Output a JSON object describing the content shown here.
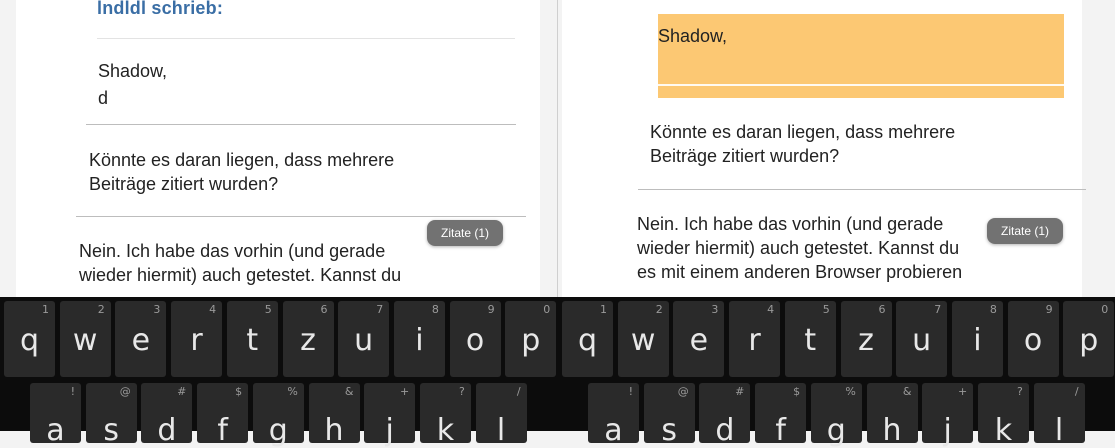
{
  "left_pane": {
    "quote_author": "lndldl schrieb:",
    "quote_lines": [
      "Shadow,",
      "d"
    ],
    "question_lines": [
      "Könnte es daran liegen, dass mehrere",
      "Beiträge zitiert wurden?"
    ],
    "reply_lines": [
      "Nein. Ich habe das vorhin (und gerade",
      "wieder hiermit) auch getestet. Kannst du"
    ],
    "quote_button": "Zitate (1)"
  },
  "right_pane": {
    "highlight_text": "Shadow,",
    "question_lines": [
      "Könnte es daran liegen, dass mehrere",
      "Beiträge zitiert wurden?"
    ],
    "reply_lines": [
      "Nein. Ich habe das vorhin (und gerade",
      "wieder hiermit) auch getestet. Kannst du",
      "es mit einem anderen Browser probieren"
    ],
    "quote_button": "Zitate (1)",
    "highlight_color": "#fcc873"
  },
  "keyboard": {
    "row1": [
      {
        "key": "q",
        "hint": "1"
      },
      {
        "key": "w",
        "hint": "2"
      },
      {
        "key": "e",
        "hint": "3"
      },
      {
        "key": "r",
        "hint": "4"
      },
      {
        "key": "t",
        "hint": "5"
      },
      {
        "key": "z",
        "hint": "6"
      },
      {
        "key": "u",
        "hint": "7"
      },
      {
        "key": "i",
        "hint": "8"
      },
      {
        "key": "o",
        "hint": "9"
      },
      {
        "key": "p",
        "hint": "0"
      }
    ],
    "row2": [
      {
        "key": "a",
        "hint": "!"
      },
      {
        "key": "s",
        "hint": "@"
      },
      {
        "key": "d",
        "hint": "#"
      },
      {
        "key": "f",
        "hint": "$"
      },
      {
        "key": "g",
        "hint": "%"
      },
      {
        "key": "h",
        "hint": "&"
      },
      {
        "key": "j",
        "hint": "+"
      },
      {
        "key": "k",
        "hint": "?"
      },
      {
        "key": "l",
        "hint": "/"
      }
    ]
  }
}
